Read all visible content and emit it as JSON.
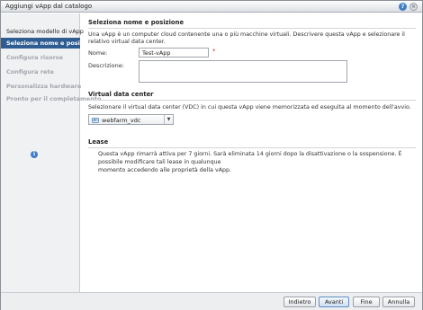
{
  "window": {
    "title": "Aggiungi vApp dal catalogo"
  },
  "sidebar": {
    "items": [
      {
        "label": "Seleziona modello di vApp",
        "state": "done"
      },
      {
        "label": "Seleziona nome e posizione",
        "state": "active"
      },
      {
        "label": "Configura risorse",
        "state": "disabled"
      },
      {
        "label": "Configura rete",
        "state": "disabled"
      },
      {
        "label": "Personalizza hardware",
        "state": "disabled"
      },
      {
        "label": "Pronto per il completamento",
        "state": "disabled"
      }
    ]
  },
  "main": {
    "name_section": {
      "title": "Seleziona nome e posizione",
      "description": "Una vApp è un computer cloud contenente una o più macchine virtuali. Descrivere questa vApp e selezionare il relativo virtual data center.",
      "name_label": "Nome:",
      "name_value": "Test-vApp",
      "required_marker": "*",
      "description_label": "Descrizione:",
      "description_value": ""
    },
    "vdc_section": {
      "title": "Virtual data center",
      "description": "Selezionare il virtual data center (VDC) in cui questa vApp viene memorizzata ed eseguita al momento dell'avvio.",
      "selected": "webfarm_vdc"
    },
    "lease_section": {
      "title": "Lease",
      "text_line1": "Questa vApp rimarrà attiva per 7 giorni. Sarà eliminata 14 giorni dopo la disattivazione o la sospensione. È possibile modificare tali lease in qualunque",
      "text_line2": "momento accedendo alle proprietà della vApp."
    }
  },
  "footer": {
    "back": "Indietro",
    "next": "Avanti",
    "finish": "Fine",
    "cancel": "Annulla"
  },
  "colors": {
    "accent": "#2f5d92",
    "info": "#3f7fc7",
    "required": "#d9302c"
  },
  "icons": [
    "help-icon",
    "close-icon",
    "vdc-icon",
    "chevron-down-icon",
    "info-icon"
  ]
}
